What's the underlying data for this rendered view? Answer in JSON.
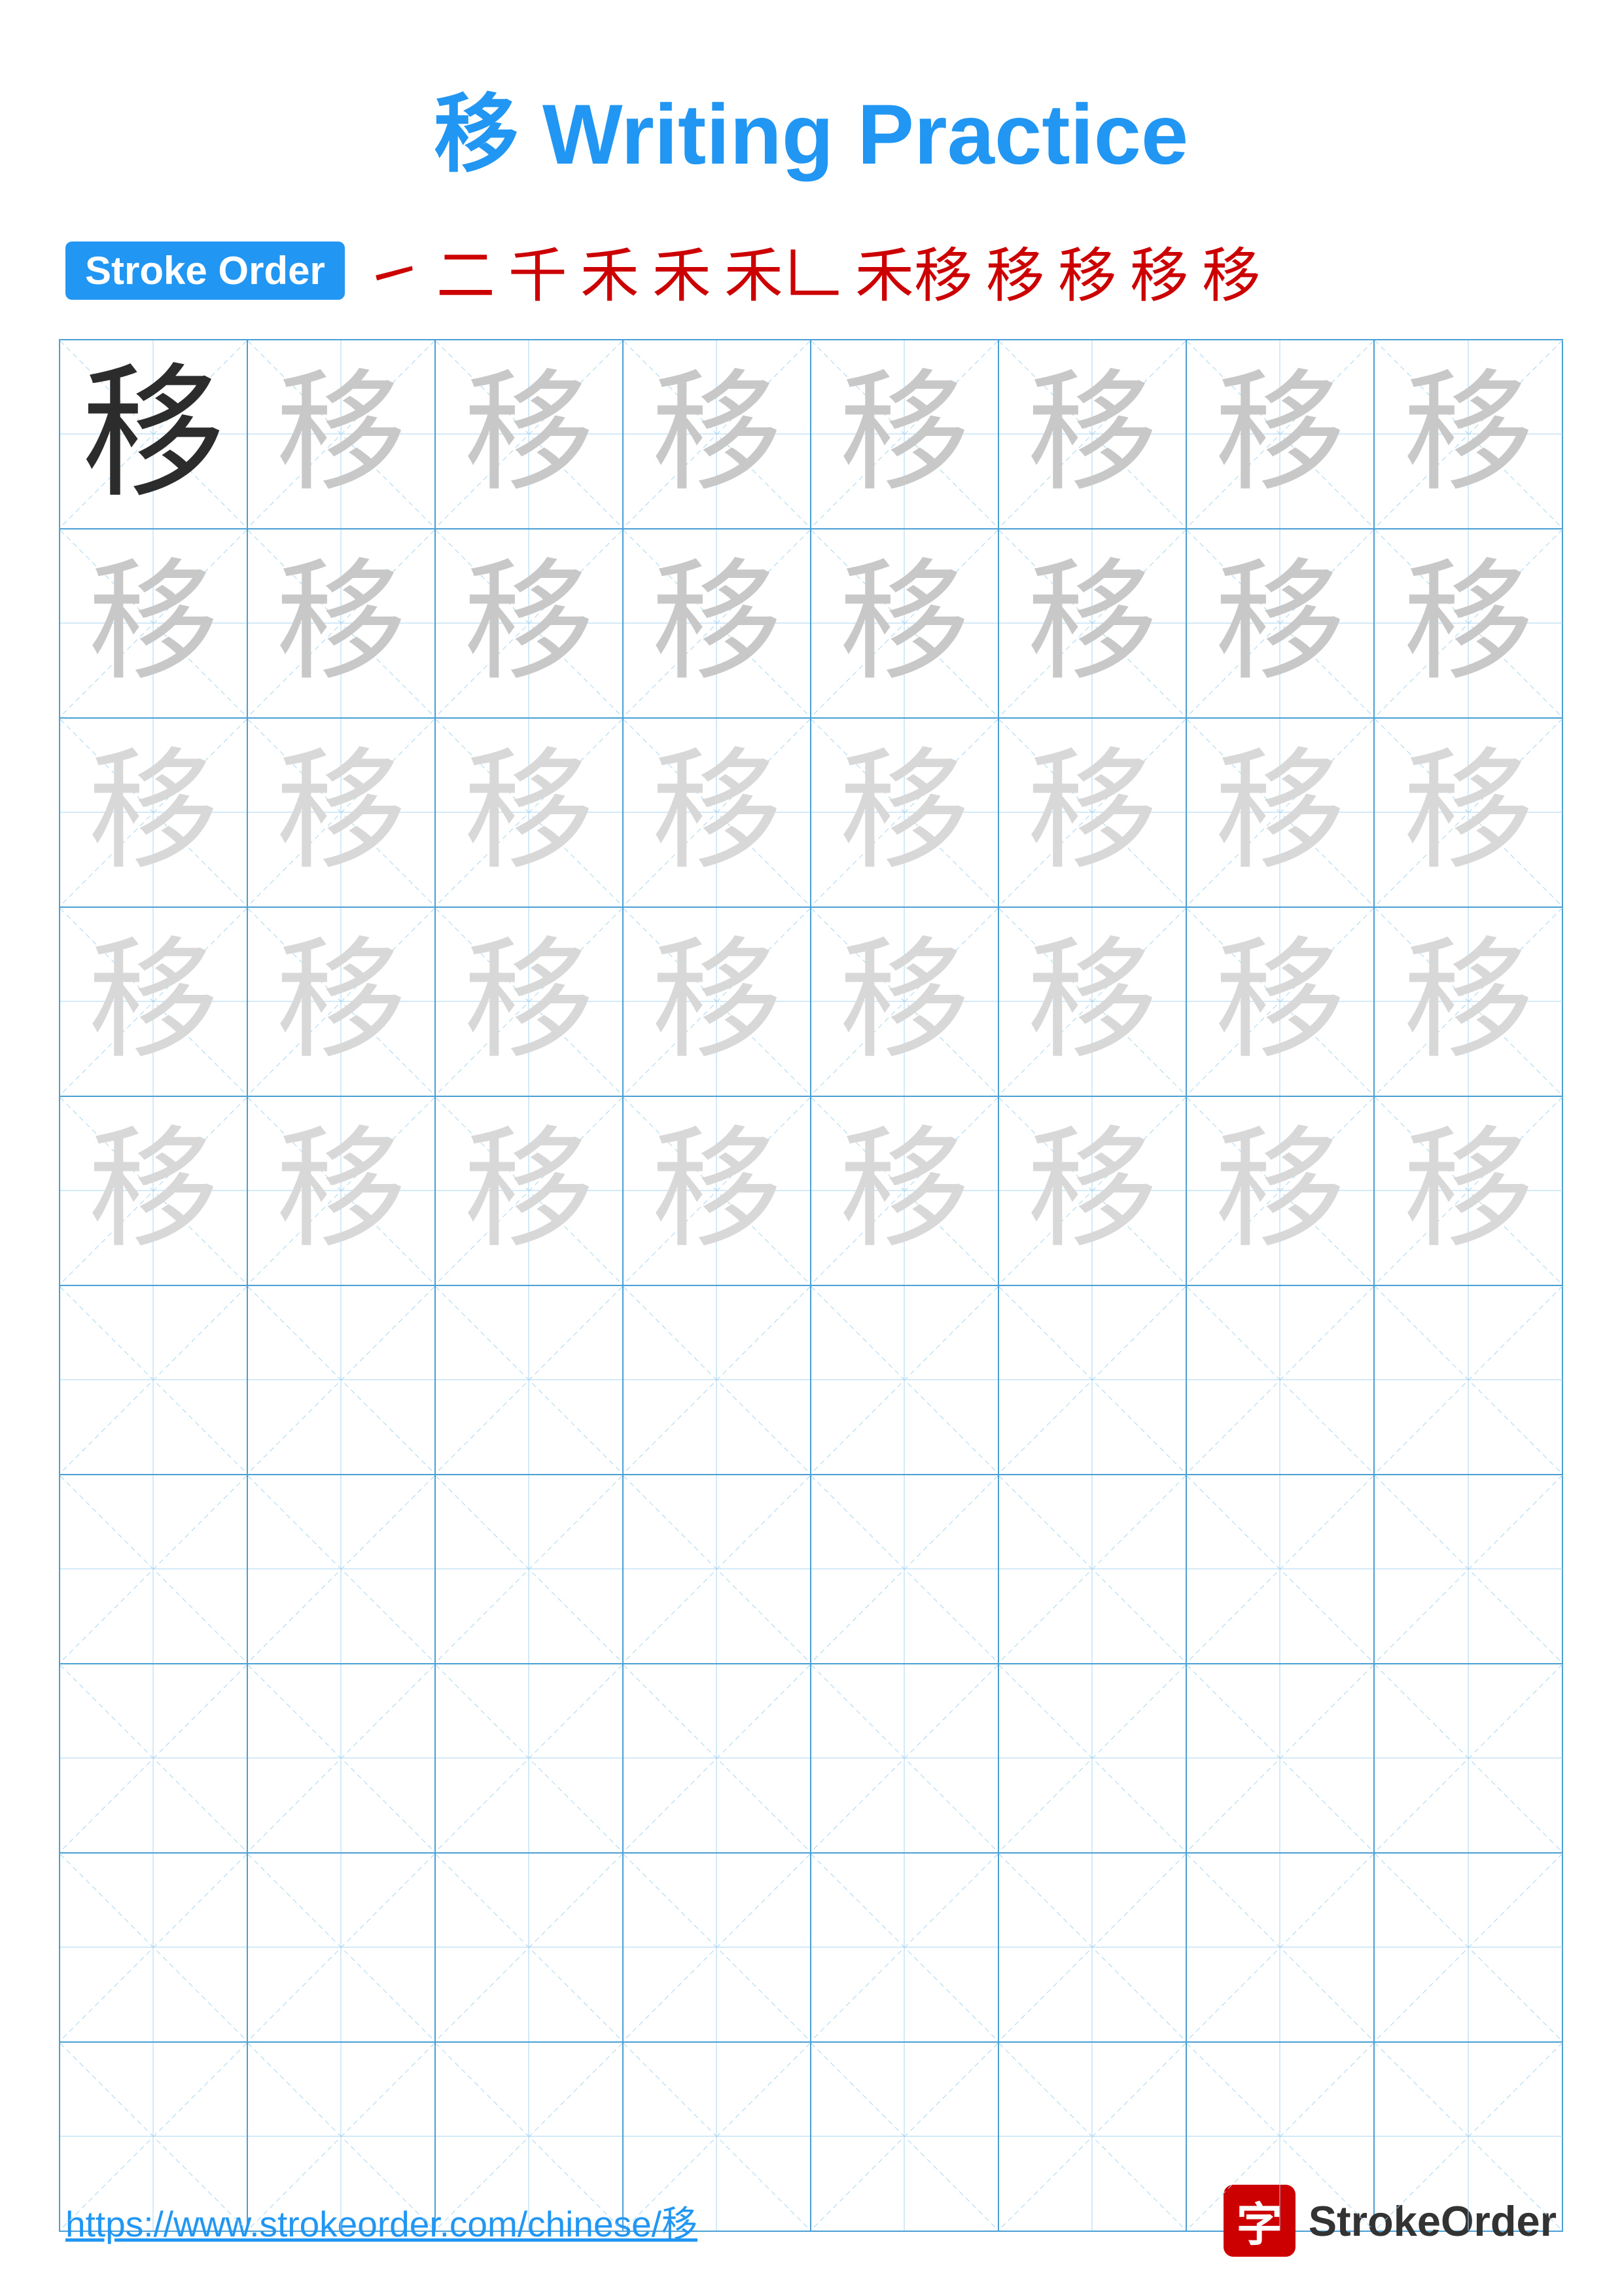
{
  "title": {
    "char": "移",
    "text": "Writing Practice",
    "full": "移 Writing Practice"
  },
  "stroke_order": {
    "badge_label": "Stroke Order",
    "strokes": [
      "丶",
      "二",
      "千",
      "禾",
      "禾",
      "禾'",
      "移'",
      "移",
      "移",
      "移",
      "移"
    ]
  },
  "grid": {
    "rows": 10,
    "cols": 8,
    "character": "移",
    "practice_rows": 5,
    "empty_rows": 5
  },
  "footer": {
    "url": "https://www.strokeorder.com/chinese/移",
    "logo_char": "字",
    "logo_text": "StrokeOrder"
  }
}
